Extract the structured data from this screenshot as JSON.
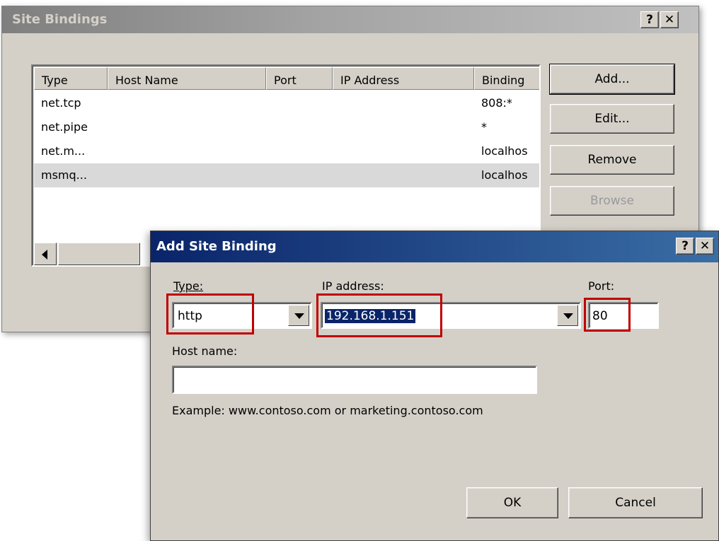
{
  "site_bindings": {
    "title": "Site Bindings",
    "help_button": "?",
    "close_button": "✕",
    "columns": [
      "Type",
      "Host Name",
      "Port",
      "IP Address",
      "Binding"
    ],
    "rows": [
      {
        "type": "net.tcp",
        "host": "",
        "port": "",
        "ip": "",
        "binding": "808:*"
      },
      {
        "type": "net.pipe",
        "host": "",
        "port": "",
        "ip": "",
        "binding": "*"
      },
      {
        "type": "net.m...",
        "host": "",
        "port": "",
        "ip": "",
        "binding": "localhos"
      },
      {
        "type": "msmq...",
        "host": "",
        "port": "",
        "ip": "",
        "binding": "localhos"
      }
    ],
    "buttons": {
      "add": "Add...",
      "edit": "Edit...",
      "remove": "Remove",
      "browse": "Browse"
    }
  },
  "add_site_binding": {
    "title": "Add Site Binding",
    "help_button": "?",
    "close_button": "✕",
    "type_label": "Type:",
    "type_value": "http",
    "ip_label": "IP address:",
    "ip_value": "192.168.1.151",
    "port_label": "Port:",
    "port_value": "80",
    "host_label": "Host name:",
    "host_value": "",
    "example_text": "Example: www.contoso.com or marketing.contoso.com",
    "ok_label": "OK",
    "cancel_label": "Cancel"
  },
  "colors": {
    "highlight": "#c00000",
    "selection": "#0a246a",
    "face": "#d4d0c8"
  }
}
